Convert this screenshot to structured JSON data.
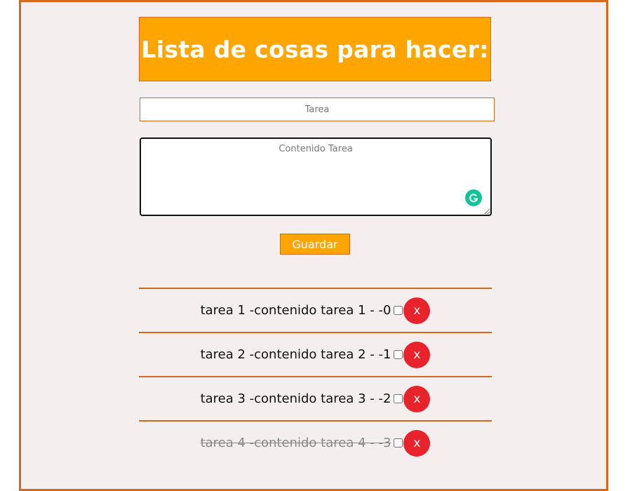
{
  "header": {
    "title": "Lista de cosas para hacer:"
  },
  "form": {
    "title_placeholder": "Tarea",
    "title_value": "",
    "content_placeholder": "Contenido Tarea",
    "content_value": "",
    "save_label": "Guardar"
  },
  "tasks": [
    {
      "text": "tarea 1 -contenido tarea 1 - -0",
      "done": false,
      "delete_label": "x"
    },
    {
      "text": "tarea 2 -contenido tarea 2 - -1",
      "done": false,
      "delete_label": "x"
    },
    {
      "text": "tarea 3 -contenido tarea 3 - -2",
      "done": false,
      "delete_label": "x"
    },
    {
      "text": "tarea 4 -contenido tarea 4 - -3",
      "done": true,
      "delete_label": "x"
    }
  ],
  "colors": {
    "accent": "#ffa500",
    "border": "#d2691e",
    "background": "#f5eeee",
    "delete": "#e8232b"
  }
}
